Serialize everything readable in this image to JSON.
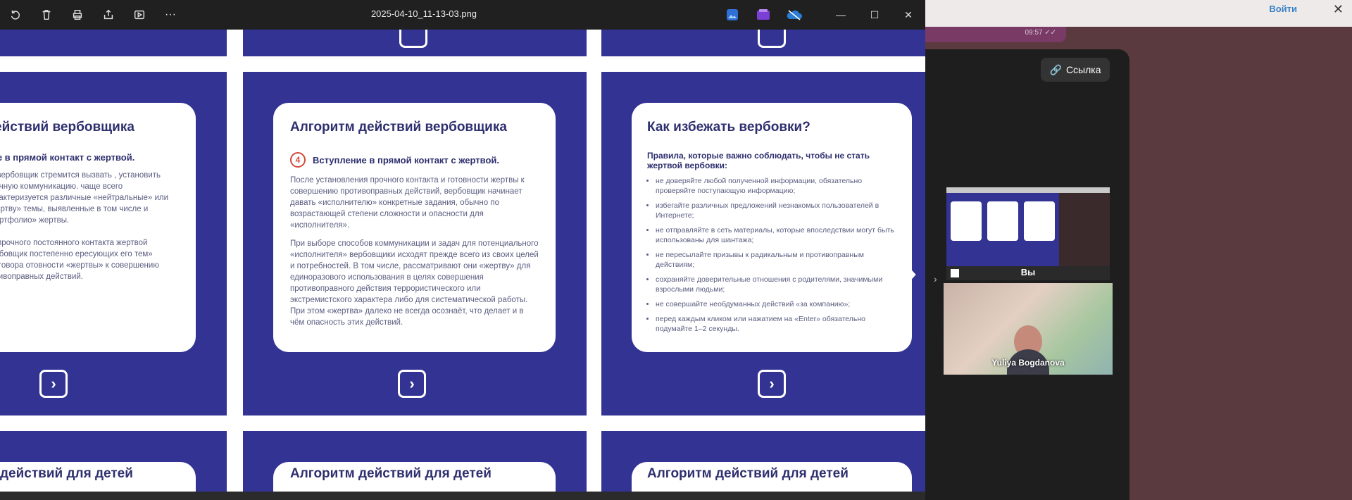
{
  "window": {
    "file_name": "2025-04-10_11-13-03.png",
    "more_label": "···",
    "minimize": "—",
    "maximize": "☐",
    "close": "✕"
  },
  "slides": {
    "col1": {
      "title": "действий вербовщика",
      "subtitle": "ние в прямой контакт с жертвой.",
      "p1": "кт, вербовщик стремится вызвать , установить прочную коммуникацию. чаще всего характеризуется различные «нейтральные» или «жертву» темы, выявленные в том числе и «портфолио» жертвы.",
      "p2": "ии прочного постоянного контакта жертвой вербовщик постепенно ересующих его тем» разговора отовности «жертвы» к совершению ротивоправных действий."
    },
    "col2": {
      "title": "Алгоритм действий вербовщика",
      "num": "4",
      "subtitle": "Вступление в прямой контакт с жертвой.",
      "p1": "После установления прочного контакта и готовности жертвы к совершению противоправных действий, вербовщик начинает давать «исполнителю» конкретные задания, обычно по возрастающей степени сложности и опасности для «исполнителя».",
      "p2": "При выборе способов коммуникации и задач для потенциального «исполнителя» вербовщики исходят прежде всего из своих целей и потребностей. В том числе, рассматривают они «жертву» для единоразового использования в целях совершения противоправного действия террористического или экстремистского характера либо для систематической работы. При этом «жертва» далеко не всегда осознаёт, что делает и в чём опасность этих действий."
    },
    "col3": {
      "title": "Как избежать вербовки?",
      "subtitle": "Правила, которые важно соблюдать, чтобы не стать жертвой вербовки:",
      "rules": [
        "не доверяйте любой полученной информации, обязательно проверяйте поступающую информацию;",
        "избегайте различных предложений незнакомых пользователей в Интернете;",
        "не отправляйте в сеть материалы, которые впоследствии могут быть использованы для шантажа;",
        "не пересылайте призывы к радикальным и противоправным действиям;",
        "сохраняйте доверительные отношения с родителями, значимыми взрослыми людьми;",
        "не совершайте необдуманных действий «за компанию»;",
        "перед каждым кликом или нажатием на «Enter» обязательно подумайте 1–2 секунды."
      ]
    },
    "bottom_titles": [
      "действий для детей",
      "Алгоритм действий для детей",
      "Алгоритм действий для детей"
    ]
  },
  "telegram": {
    "login_label": "Войти",
    "close_label": "✕",
    "msg_time": "09:57 ✓✓",
    "link_label": "Ссылка",
    "self_label": "Вы",
    "participant_name": "Yuliya Bogdanova",
    "expand_chevron": "›"
  }
}
